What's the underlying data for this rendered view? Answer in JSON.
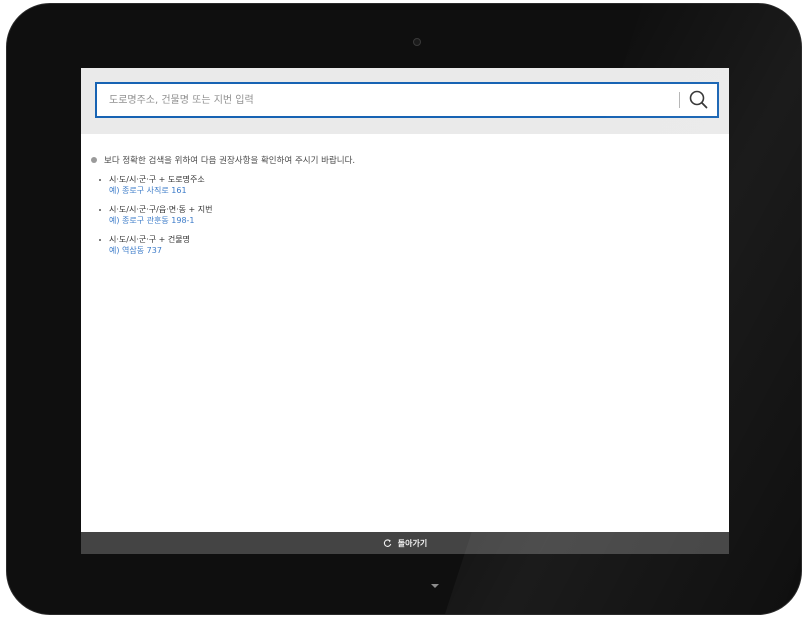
{
  "search": {
    "placeholder": "도로명주소, 건물명 또는 지번 입력",
    "value": ""
  },
  "notice": {
    "text": "보다 정확한 검색을 위하여 다음 권장사항을 확인하여 주시기 바랍니다."
  },
  "tips": [
    {
      "format": "시·도/시·군·구 + 도로명주소",
      "example": "예) 종로구 사직로 161"
    },
    {
      "format": "시·도/시·군·구/읍·면·동 + 지번",
      "example": "예) 종로구 관훈동 198-1"
    },
    {
      "format": "시·도/시·군·구 + 건물명",
      "example": "예) 역삼동 737"
    }
  ],
  "bottom_bar": {
    "back_label": "돌아가기"
  },
  "colors": {
    "accent": "#1763b3",
    "example_text": "#3d7cc9",
    "bottom_bar": "#444444",
    "search_band": "#eaeaea"
  },
  "icons": {
    "search": "search-icon",
    "back": "refresh-icon",
    "home": "chevron-down-icon"
  }
}
